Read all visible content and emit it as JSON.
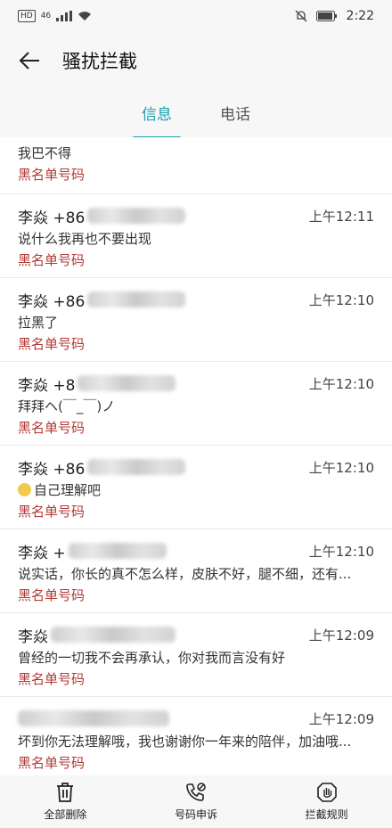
{
  "status": {
    "network": "46",
    "time": "2:22"
  },
  "header": {
    "title": "骚扰拦截"
  },
  "tabs": [
    {
      "label": "信息",
      "active": true
    },
    {
      "label": "电话",
      "active": false
    }
  ],
  "items": [
    {
      "name": "",
      "time": "",
      "message": "我巴不得",
      "tag": "黑名单号码"
    },
    {
      "name": "李焱 +86",
      "time": "上午12:11",
      "message": "说什么我再也不要出现",
      "tag": "黑名单号码"
    },
    {
      "name": "李焱 +86",
      "time": "上午12:10",
      "message": "拉黑了",
      "tag": "黑名单号码"
    },
    {
      "name": "李焱 +8",
      "time": "上午12:10",
      "message": "拜拜ヘ(￣_￣)ノ",
      "tag": "黑名单号码"
    },
    {
      "name": "李焱 +86",
      "time": "上午12:10",
      "message": "自己理解吧",
      "tag": "黑名单号码",
      "emoji": true
    },
    {
      "name": "李焱 +",
      "time": "上午12:10",
      "message": "说实话，你长的真不怎么样，皮肤不好，腿不细，还有...",
      "tag": "黑名单号码"
    },
    {
      "name": "李焱",
      "time": "上午12:09",
      "message": "曾经的一切我不会再承认，你对我而言没有好",
      "tag": "黑名单号码"
    },
    {
      "name": "",
      "time": "上午12:09",
      "message": "坏到你无法理解哦，我也谢谢你一年来的陪伴，加油哦...",
      "tag": "黑名单号码"
    }
  ],
  "bottom": {
    "delete_all": "全部删除",
    "appeal": "号码申诉",
    "rules": "拦截规则"
  },
  "accent": "#1a9fb1",
  "tag_color": "#b23a35"
}
